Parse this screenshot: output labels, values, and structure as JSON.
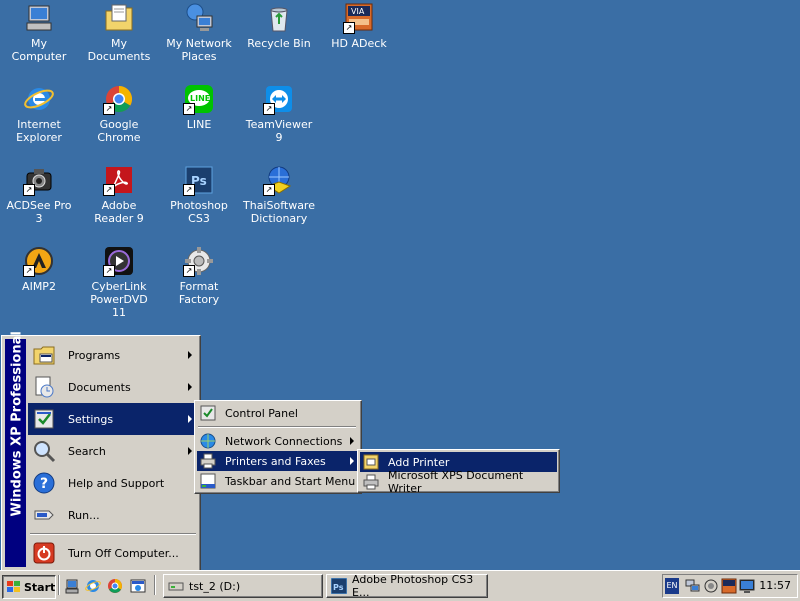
{
  "desktop": {
    "icons": [
      {
        "label": "My Computer",
        "icon": "my-computer-icon"
      },
      {
        "label": "My Documents",
        "icon": "my-documents-icon"
      },
      {
        "label": "My Network Places",
        "icon": "network-places-icon"
      },
      {
        "label": "Recycle Bin",
        "icon": "recycle-bin-icon"
      },
      {
        "label": "HD ADeck",
        "icon": "hd-adeck-icon"
      },
      {
        "label": "Internet Explorer",
        "icon": "internet-explorer-icon"
      },
      {
        "label": "Google Chrome",
        "icon": "chrome-icon"
      },
      {
        "label": "LINE",
        "icon": "line-icon"
      },
      {
        "label": "TeamViewer 9",
        "icon": "teamviewer-icon"
      },
      {
        "label": "ACDSee Pro 3",
        "icon": "acdsee-icon"
      },
      {
        "label": "Adobe Reader 9",
        "icon": "adobe-reader-icon"
      },
      {
        "label": "Photoshop CS3",
        "icon": "photoshop-icon"
      },
      {
        "label": "ThaiSoftware Dictionary",
        "icon": "dictionary-icon"
      },
      {
        "label": "AIMP2",
        "icon": "aimp-icon"
      },
      {
        "label": "CyberLink PowerDVD 11",
        "icon": "powerdvd-icon"
      },
      {
        "label": "Format Factory",
        "icon": "format-factory-icon"
      }
    ]
  },
  "start_menu": {
    "sidebar_text": "Windows XP Professional",
    "items": [
      {
        "label": "Programs"
      },
      {
        "label": "Documents"
      },
      {
        "label": "Settings"
      },
      {
        "label": "Search"
      },
      {
        "label": "Help and Support"
      },
      {
        "label": "Run..."
      },
      {
        "label": "Turn Off Computer..."
      }
    ]
  },
  "settings_menu": {
    "items": [
      {
        "label": "Control Panel"
      },
      {
        "label": "Network Connections"
      },
      {
        "label": "Printers and Faxes"
      },
      {
        "label": "Taskbar and Start Menu"
      }
    ]
  },
  "printers_menu": {
    "items": [
      {
        "label": "Add Printer"
      },
      {
        "label": "Microsoft XPS Document Writer"
      }
    ]
  },
  "taskbar": {
    "start_label": "Start",
    "buttons": [
      {
        "label": "tst_2 (D:)"
      },
      {
        "label": "Adobe Photoshop CS3 E..."
      }
    ],
    "tray": {
      "lang": "EN",
      "clock": "11:57"
    }
  },
  "colors": {
    "desktop": "#3a6ea5",
    "highlight": "#0a246a",
    "sidebar": "#000080",
    "face": "#d4d0c8"
  }
}
